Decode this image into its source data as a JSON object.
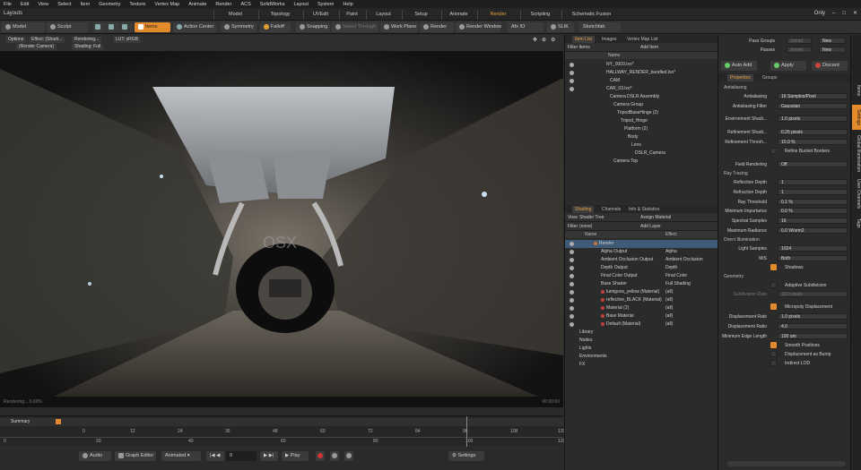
{
  "menu": [
    "File",
    "Edit",
    "View",
    "Select",
    "Item",
    "Geometry",
    "Texture",
    "Vertex Map",
    "Animate",
    "Render",
    "ACS",
    "SolidWorks",
    "Layout",
    "System",
    "Help"
  ],
  "layouts_label": "Layouts",
  "layout_tabs": [
    {
      "label": "Model",
      "active": false
    },
    {
      "label": "Topology",
      "active": false
    },
    {
      "label": "UVEdit",
      "active": false
    },
    {
      "label": "Paint",
      "active": false
    },
    {
      "label": "Layout",
      "active": false
    },
    {
      "label": "Setup",
      "active": false
    },
    {
      "label": "Animate",
      "active": false
    },
    {
      "label": "Render",
      "active": true
    },
    {
      "label": "Scripting",
      "active": false
    },
    {
      "label": "Schematic Fusion",
      "active": false
    }
  ],
  "window_only": "Only",
  "toolbar": {
    "model": "Model",
    "sculpt": "Sculpt",
    "items": "Items",
    "action_center": "Action Center",
    "symmetry": "Symmetry",
    "falloff": "Falloff",
    "snapping": "Snapping",
    "select_through": "Select Through",
    "work_plane": "Work Plane",
    "render": "Render",
    "render_window": "Render Window",
    "afx": "Afx IO",
    "slik": "SLIK",
    "sketchfab": "Sketchfab"
  },
  "viewport": {
    "options": "Options",
    "effect": "Effect: (Shadi...",
    "rendering": "Rendering...",
    "lut": "LUT: sRGB",
    "camera": "(Render Camera)",
    "shading": "Shading: Full",
    "status_left": "Rendering... 0.00%",
    "status_right": "00:00:00",
    "watermark": "OSX"
  },
  "timeline": {
    "summary": "Summary",
    "ticks_top": [
      "0",
      "12",
      "24",
      "36",
      "48",
      "60",
      "72",
      "84",
      "96",
      "108",
      "120"
    ],
    "ticks_bottom": [
      "0",
      "",
      "20",
      "",
      "40",
      "",
      "60",
      "",
      "80",
      "",
      "100",
      "",
      "120"
    ]
  },
  "bottombar": {
    "audio": "Audio",
    "graph_editor": "Graph Editor",
    "animated": "Animated",
    "frame": "0",
    "play": "Play",
    "settings": "Settings"
  },
  "itemlist": {
    "tabs": [
      {
        "label": "Item List",
        "active": true
      },
      {
        "label": "Images",
        "active": false
      },
      {
        "label": "Vertex Map List",
        "active": false
      }
    ],
    "filter": "Filter Items",
    "add_item": "Add Item",
    "col_name": "Name",
    "rows": [
      {
        "label": "NY_0009.lxo*",
        "indent": 6,
        "eye": true
      },
      {
        "label": "HALLWAY_RENDER_bundled.lxo*",
        "indent": 6,
        "eye": true
      },
      {
        "label": "CAM",
        "indent": 10,
        "eye": true
      },
      {
        "label": "CAR_03.lxo*",
        "indent": 6,
        "eye": true
      },
      {
        "label": "Camera DSLR Assembly",
        "indent": 10,
        "eye": false
      },
      {
        "label": "Camera Group",
        "indent": 14,
        "eye": false
      },
      {
        "label": "TripodBaseHinge (2)",
        "indent": 18,
        "eye": false
      },
      {
        "label": "Tripod_Hinge",
        "indent": 22,
        "eye": false
      },
      {
        "label": "Platform (2)",
        "indent": 26,
        "eye": false
      },
      {
        "label": "Body",
        "indent": 30,
        "eye": false
      },
      {
        "label": "Lens",
        "indent": 34,
        "eye": false
      },
      {
        "label": "DSLR_Camera",
        "indent": 38,
        "eye": false
      },
      {
        "label": "Camera Top",
        "indent": 14,
        "eye": false
      }
    ]
  },
  "shading": {
    "tabs": [
      {
        "label": "Shading",
        "active": true
      },
      {
        "label": "Channels",
        "active": false
      },
      {
        "label": "Info & Statistics",
        "active": false
      }
    ],
    "view_label": "View",
    "view_value": "Shader Tree",
    "assign_material": "Assign Material",
    "filter_label": "Filter",
    "filter_value": "(none)",
    "add_layer": "Add Layer",
    "col_name": "Name",
    "col_effect": "Effect",
    "rows": [
      {
        "label": "Render",
        "effect": "",
        "color": "#d07030",
        "sel": true
      },
      {
        "label": "Alpha Output",
        "effect": "Alpha",
        "color": ""
      },
      {
        "label": "Ambient Occlusion Output",
        "effect": "Ambient Occlusion",
        "color": ""
      },
      {
        "label": "Depth Output",
        "effect": "Depth",
        "color": ""
      },
      {
        "label": "Final Color Output",
        "effect": "Final Color",
        "color": ""
      },
      {
        "label": "Base Shader",
        "effect": "Full Shading",
        "color": ""
      },
      {
        "label": "lumigons_yellow (Material)",
        "effect": "(all)",
        "color": "#c04040"
      },
      {
        "label": "reflective_BLACK (Material)",
        "effect": "(all)",
        "color": "#c04040"
      },
      {
        "label": "Material (2)",
        "effect": "(all)",
        "color": "#c04040"
      },
      {
        "label": "Base Material",
        "effect": "(all)",
        "color": "#c04040"
      },
      {
        "label": "Default (Material)",
        "effect": "(all)",
        "color": "#c04040"
      },
      {
        "label": "Library",
        "effect": "",
        "color": ""
      },
      {
        "label": "Nodes",
        "effect": "",
        "color": ""
      },
      {
        "label": "Lights",
        "effect": "",
        "color": ""
      },
      {
        "label": "Environments",
        "effect": "",
        "color": ""
      },
      {
        "label": "FX",
        "effect": "",
        "color": ""
      }
    ]
  },
  "properties": {
    "pass_groups": "Pass Groups",
    "passes": "Passes",
    "none": "(none)",
    "new": "New",
    "auto_add": "Auto Add",
    "apply": "Apply",
    "discard": "Discard",
    "tabs": [
      {
        "label": "Properties",
        "active": true
      },
      {
        "label": "Groups",
        "active": false
      }
    ],
    "sections": {
      "antialiasing": "Antialiasing",
      "ray_tracing": "Ray Tracing",
      "direct_illumination": "Direct Illumination",
      "geometry": "Geometry"
    },
    "fields": {
      "antialiasing": {
        "label": "Antialiasing",
        "value": "16 Samples/Pixel"
      },
      "aa_filter": {
        "label": "Antialiasing Filter",
        "value": "Gaussian"
      },
      "env_shading": {
        "label": "Environment Shadi...",
        "value": "1.0 pixels"
      },
      "refine_shading": {
        "label": "Refinement Shadi...",
        "value": "0.25 pixels"
      },
      "refine_thresh": {
        "label": "Refinement Thresh...",
        "value": "10.0 %"
      },
      "refine_bucket": "Refine Bucket Borders",
      "field_rendering": {
        "label": "Field Rendering",
        "value": "Off"
      },
      "reflection_depth": {
        "label": "Reflection Depth",
        "value": "1"
      },
      "refraction_depth": {
        "label": "Refraction Depth",
        "value": "1"
      },
      "ray_threshold": {
        "label": "Ray Threshold",
        "value": "0.1 %"
      },
      "min_importance": {
        "label": "Minimum Importance",
        "value": "0.0 %"
      },
      "spectral_samples": {
        "label": "Spectral Samples",
        "value": "16"
      },
      "max_radiance": {
        "label": "Maximum Radiance",
        "value": "0.0 W/srm2"
      },
      "light_samples": {
        "label": "Light Samples",
        "value": "1024"
      },
      "mis": {
        "label": "MIS",
        "value": "Both"
      },
      "shadows": "Shadows",
      "adaptive_subdiv": "Adaptive Subdivision",
      "subdiv_rate": {
        "label": "Subdivision Rate",
        "value": "10.0 pixels"
      },
      "micropoly": "Micropoly Displacement",
      "disp_rate": {
        "label": "Displacement Rate",
        "value": "1.0 pixels"
      },
      "disp_ratio": {
        "label": "Displacement Ratio",
        "value": "4.0"
      },
      "min_edge": {
        "label": "Minimum Edge Length",
        "value": "100 um"
      },
      "smooth_positions": "Smooth Positions",
      "disp_as_bump": "Displacement as Bump",
      "indirect_lod": "Indirect LOD"
    }
  },
  "side_tabs": [
    "Items",
    "Settings",
    "Global Illumination",
    "User Channels",
    "Tags"
  ]
}
